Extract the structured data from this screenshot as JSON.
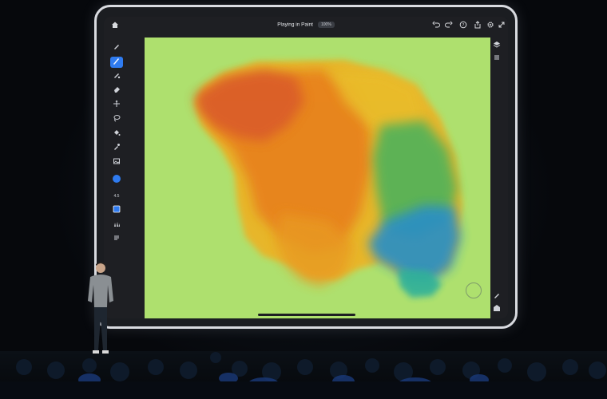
{
  "app": {
    "document_title": "Playing in Paint",
    "zoom_label": "100%"
  },
  "top_toolbar": {
    "left_icons": [
      "home-icon"
    ],
    "right_icons": [
      "undo-icon",
      "redo-icon",
      "help-icon",
      "share-icon",
      "settings-icon",
      "fullscreen-icon"
    ]
  },
  "left_toolbar": {
    "tools": [
      "pixel-brush-icon",
      "live-brush-icon",
      "vector-brush-icon",
      "eraser-icon",
      "transform-icon",
      "lasso-icon",
      "fill-icon",
      "eyedropper-icon",
      "image-icon"
    ],
    "active_tool": "live-brush-icon",
    "brush_size_label": "4.5",
    "current_color": "#2f7bf0"
  },
  "right_toolbar": {
    "icons": [
      "layers-icon",
      "layer-properties-icon",
      "brush-settings-icon",
      "fit-icon"
    ]
  },
  "colors": {
    "canvas_background": "#aee06e",
    "accent": "#2f7bf0"
  }
}
